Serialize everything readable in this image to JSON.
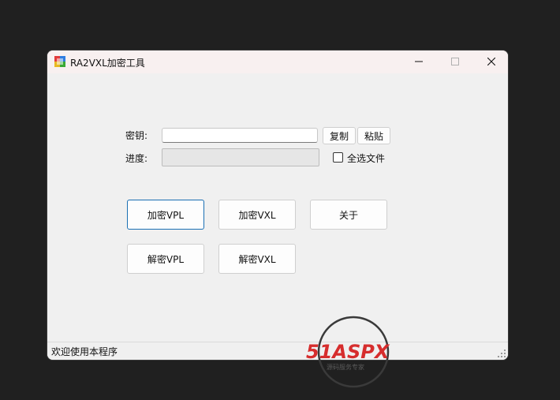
{
  "window": {
    "title": "RA2VXL加密工具",
    "controls": {
      "minimize_icon": "minimize-icon",
      "maximize_icon": "maximize-icon",
      "close_icon": "close-icon"
    }
  },
  "form": {
    "key_label": "密钥:",
    "key_value": "",
    "copy_label": "复制",
    "paste_label": "粘贴",
    "progress_label": "进度:",
    "progress_value": 0,
    "select_all_label": "全选文件",
    "select_all_checked": false
  },
  "buttons": {
    "encrypt_vpl": "加密VPL",
    "encrypt_vxl": "加密VXL",
    "about": "关于",
    "decrypt_vpl": "解密VPL",
    "decrypt_vxl": "解密VXL"
  },
  "status": {
    "text": "欢迎使用本程序"
  },
  "watermark": {
    "brand": "51ASPX",
    "sub": "源码服务专家"
  },
  "colors": {
    "focus_border": "#1a6fb3",
    "brand_red": "#d62d2d",
    "brand_green": "#3aa935"
  }
}
